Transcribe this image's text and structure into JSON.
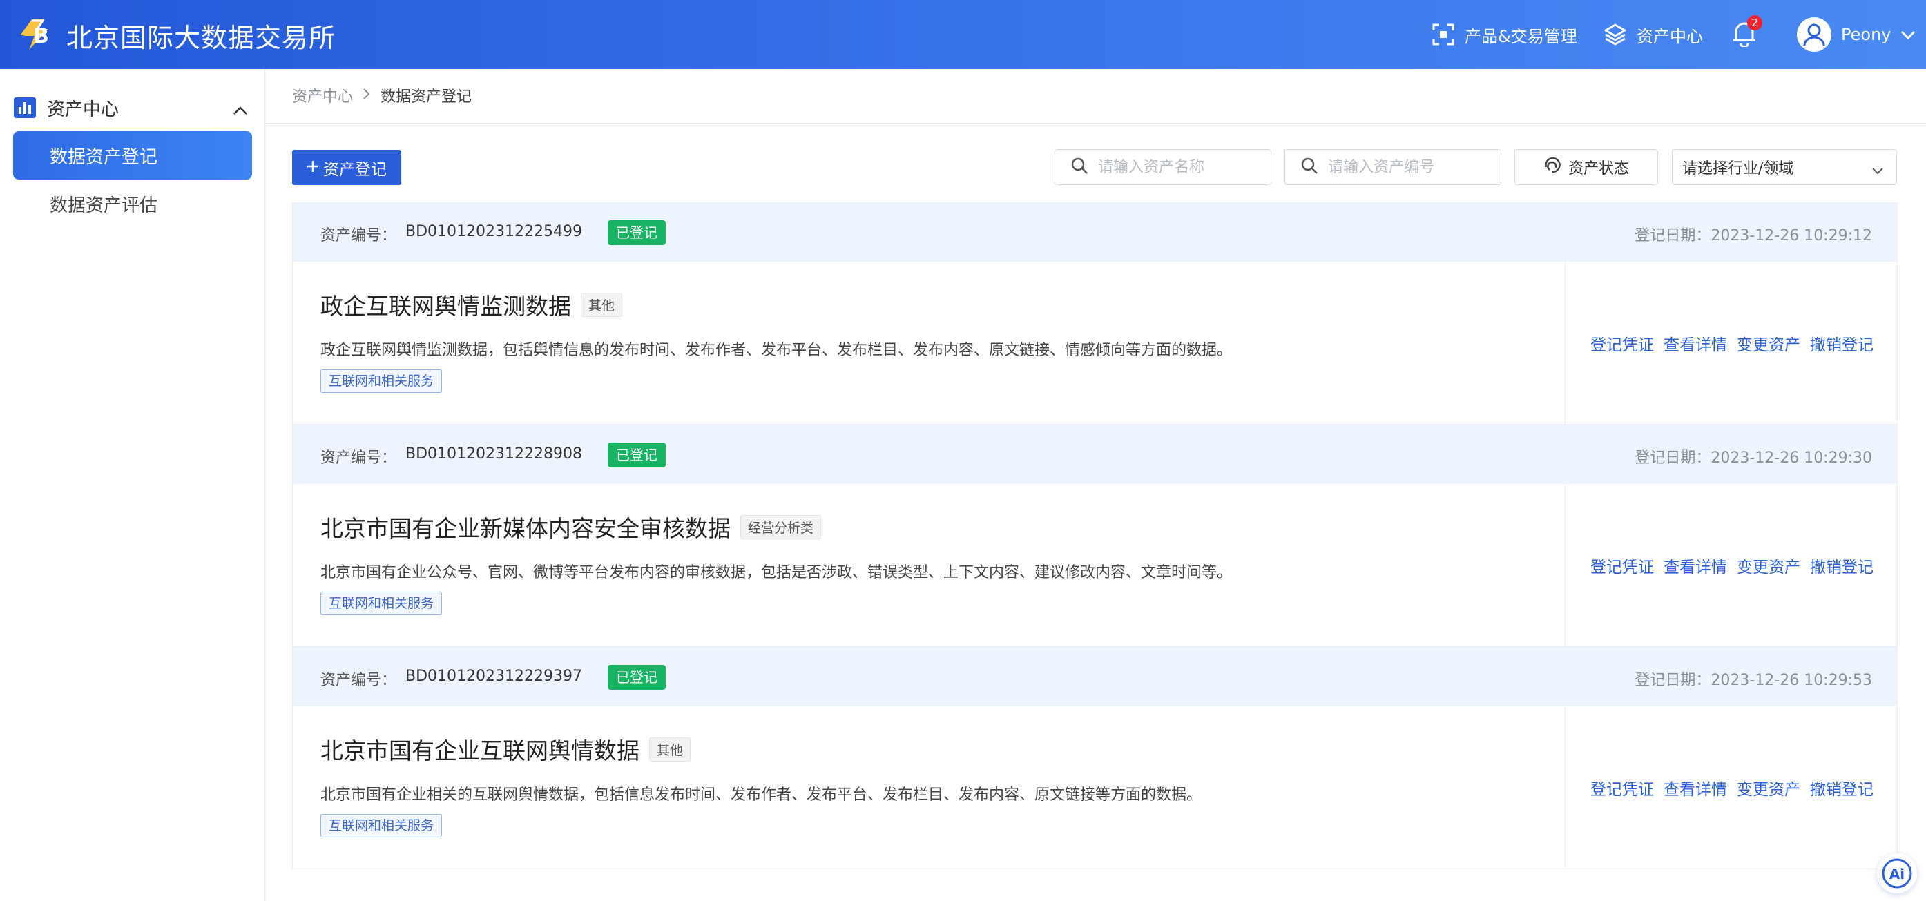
{
  "header": {
    "brand": "北京国际大数据交易所",
    "nav": [
      {
        "icon": "scan-frame-icon",
        "label": "产品&交易管理"
      },
      {
        "icon": "layers-icon",
        "label": "资产中心"
      }
    ],
    "notifications": {
      "icon": "bell-icon",
      "count": "2"
    },
    "user": {
      "name": "Peony",
      "icon": "user-avatar-icon"
    }
  },
  "sidebar": {
    "group": {
      "label": "资产中心",
      "icon": "bar-chart-icon"
    },
    "items": [
      {
        "label": "数据资产登记",
        "active": true
      },
      {
        "label": "数据资产评估",
        "active": false
      }
    ]
  },
  "breadcrumb": {
    "parent": "资产中心",
    "current": "数据资产登记"
  },
  "toolbar": {
    "add_label": "资产登记",
    "search_name_placeholder": "请输入资产名称",
    "search_code_placeholder": "请输入资产编号",
    "status_label": "资产状态",
    "industry_placeholder": "请选择行业/领域"
  },
  "records_labels": {
    "id_label": "资产编号：",
    "date_label": "登记日期："
  },
  "records": [
    {
      "id": "BD0101202312225499",
      "status": "已登记",
      "date": "2023-12-26 10:29:12",
      "title": "政企互联网舆情监测数据",
      "category": "其他",
      "description": "政企互联网舆情监测数据，包括舆情信息的发布时间、发布作者、发布平台、发布栏目、发布内容、原文链接、情感倾向等方面的数据。",
      "tag": "互联网和相关服务",
      "actions": [
        "登记凭证",
        "查看详情",
        "变更资产",
        "撤销登记"
      ]
    },
    {
      "id": "BD0101202312228908",
      "status": "已登记",
      "date": "2023-12-26 10:29:30",
      "title": "北京市国有企业新媒体内容安全审核数据",
      "category": "经营分析类",
      "description": "北京市国有企业公众号、官网、微博等平台发布内容的审核数据，包括是否涉政、错误类型、上下文内容、建议修改内容、文章时间等。",
      "tag": "互联网和相关服务",
      "actions": [
        "登记凭证",
        "查看详情",
        "变更资产",
        "撤销登记"
      ]
    },
    {
      "id": "BD0101202312229397",
      "status": "已登记",
      "date": "2023-12-26 10:29:53",
      "title": "北京市国有企业互联网舆情数据",
      "category": "其他",
      "description": "北京市国有企业相关的互联网舆情数据，包括信息发布时间、发布作者、发布平台、发布栏目、发布内容、原文链接等方面的数据。",
      "tag": "互联网和相关服务",
      "actions": [
        "登记凭证",
        "查看详情",
        "变更资产",
        "撤销登记"
      ]
    }
  ],
  "ai_assistant": {
    "label": "Ai",
    "icon": "ai-assistant-icon"
  },
  "colors": {
    "primary": "#2b5fd9",
    "header_start": "#2357d8",
    "header_end": "#4a8af2",
    "status_green": "#18b463",
    "badge_red": "#f5222d"
  }
}
